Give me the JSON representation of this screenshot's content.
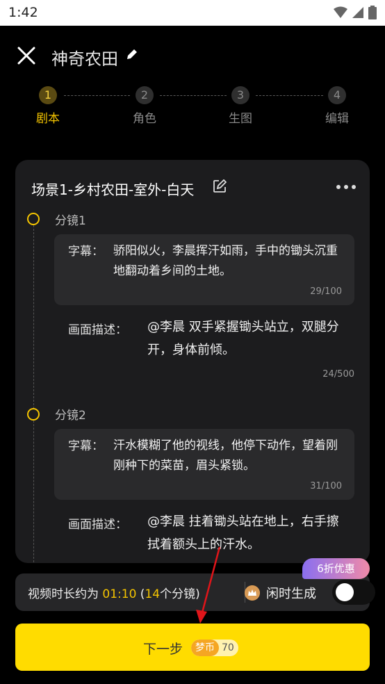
{
  "status_bar": {
    "time": "1:42"
  },
  "header": {
    "title": "神奇农田"
  },
  "steps": [
    {
      "number": "1",
      "label": "剧本",
      "active": true
    },
    {
      "number": "2",
      "label": "角色",
      "active": false
    },
    {
      "number": "3",
      "label": "生图",
      "active": false
    },
    {
      "number": "4",
      "label": "编辑",
      "active": false
    }
  ],
  "scene": {
    "title": "场景1-乡村农田-室外-白天"
  },
  "shots": [
    {
      "label": "分镜1",
      "subtitle_key": "字幕：",
      "subtitle": "骄阳似火，李晨挥汗如雨，手中的锄头沉重地翻动着乡间的土地。",
      "subtitle_count": "29/100",
      "desc_key": "画面描述：",
      "desc": "@李晨 双手紧握锄头站立，双腿分开，身体前倾。",
      "desc_count": "24/500"
    },
    {
      "label": "分镜2",
      "subtitle_key": "字幕：",
      "subtitle": "汗水模糊了他的视线，他停下动作，望着刚刚种下的菜苗，眉头紧锁。",
      "subtitle_count": "31/100",
      "desc_key": "画面描述：",
      "desc": "@李晨 拄着锄头站在地上，右手擦拭着额头上的汗水。"
    }
  ],
  "info": {
    "prefix": "视频时长约为 ",
    "duration": "01:10",
    "open": " (",
    "count": "14",
    "suffix": "个分镜)",
    "idle_label": "闲时生成",
    "idle_enabled": false
  },
  "promo": "6折优惠",
  "next": {
    "label": "下一步",
    "coin_name": "梦币",
    "coin_value": "70"
  },
  "colors": {
    "accent": "#ffdc00",
    "highlight": "#f4c400",
    "card": "#1c1c1e"
  }
}
